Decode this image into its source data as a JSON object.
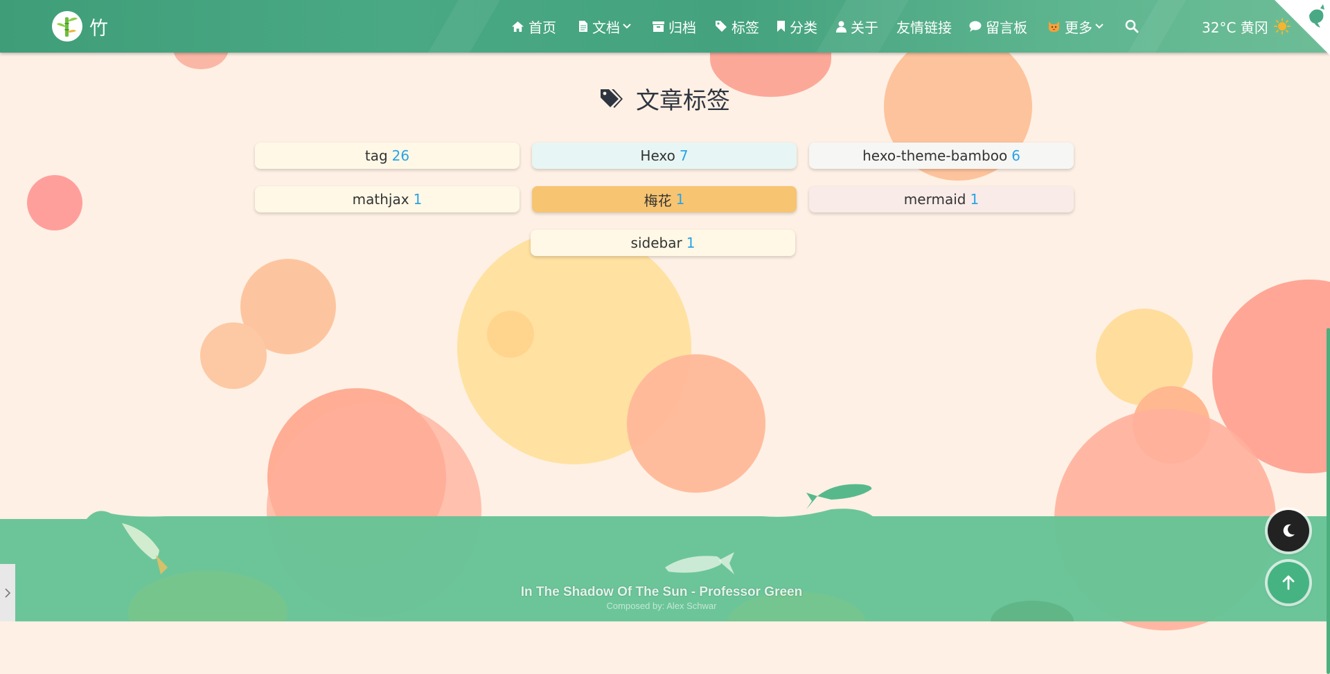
{
  "site": {
    "logo_text": "竹"
  },
  "nav": {
    "items": [
      {
        "label": "首页",
        "icon": "home-icon"
      },
      {
        "label": "文档",
        "icon": "document-icon",
        "dropdown": true
      },
      {
        "label": "归档",
        "icon": "archive-icon"
      },
      {
        "label": "标签",
        "icon": "tag-icon"
      },
      {
        "label": "分类",
        "icon": "bookmark-icon"
      },
      {
        "label": "关于",
        "icon": "user-icon"
      },
      {
        "label": "友情链接",
        "icon": ""
      },
      {
        "label": "留言板",
        "icon": "comment-icon"
      },
      {
        "label": "更多",
        "icon": "cat-icon",
        "dropdown": true
      }
    ],
    "search_icon": "search-icon",
    "weather_text": "32°C 黄冈",
    "weather_icon": "sun-icon"
  },
  "main": {
    "title": "文章标签",
    "title_icon": "tags-icon",
    "tags": [
      {
        "name": "tag",
        "count": "26",
        "bg": "#fff8e6"
      },
      {
        "name": "Hexo",
        "count": "7",
        "bg": "#e7f6f4"
      },
      {
        "name": "hexo-theme-bamboo",
        "count": "6",
        "bg": "#f6f6f4"
      },
      {
        "name": "mathjax",
        "count": "1",
        "bg": "#fff8e6"
      },
      {
        "name": "梅花",
        "count": "1",
        "bg": "#f7c471"
      },
      {
        "name": "mermaid",
        "count": "1",
        "bg": "#f8ebe8"
      },
      {
        "name": "sidebar",
        "count": "1",
        "bg": "#fff8e6"
      }
    ]
  },
  "footer": {
    "song": "In The Shadow Of The Sun - Professor Green",
    "composer": "Composed by:  Alex Schwar"
  },
  "colors": {
    "accent": "#4aa985",
    "tag_count": "#29a3e6",
    "ground": "#67c396"
  }
}
